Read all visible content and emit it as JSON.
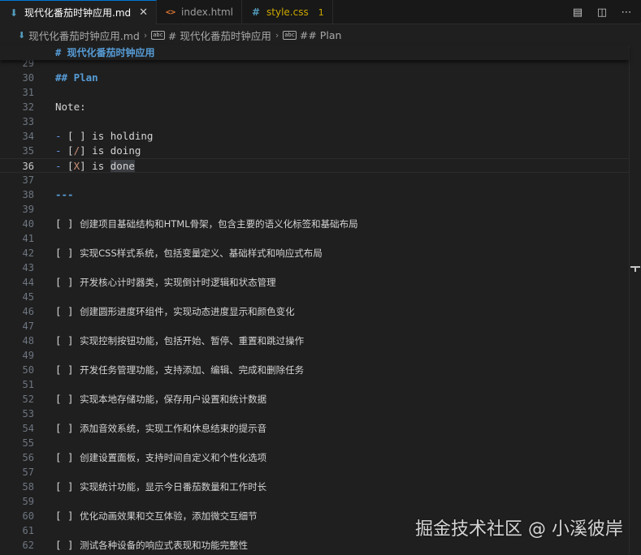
{
  "tabs": [
    {
      "label": "现代化番茄时钟应用.md",
      "icon": "markdown-icon",
      "active": true,
      "close": "✕"
    },
    {
      "label": "index.html",
      "icon": "html-icon",
      "icon_glyph": "<>"
    },
    {
      "label": "style.css",
      "icon": "css-icon",
      "icon_glyph": "#",
      "badge": "1"
    }
  ],
  "tab_actions": [
    "preview-icon",
    "split-editor-icon",
    "more-icon"
  ],
  "breadcrumb": [
    "现代化番茄时钟应用.md",
    "# 现代化番茄时钟应用",
    "## Plan"
  ],
  "sticky_heading": "# 现代化番茄时钟应用",
  "editor": {
    "current_line": 36,
    "lines": [
      {
        "n": "29",
        "text": ""
      },
      {
        "n": "30",
        "text": "## Plan"
      },
      {
        "n": "31",
        "text": ""
      },
      {
        "n": "32",
        "text": "Note:"
      },
      {
        "n": "33",
        "text": ""
      },
      {
        "n": "34",
        "dash": "-",
        "open": " [ ]",
        "rest": " is holding"
      },
      {
        "n": "35",
        "dash": "-",
        "open": " [",
        "mark": "/",
        "close": "]",
        "rest": " is doing"
      },
      {
        "n": "36",
        "dash": "-",
        "open": " [",
        "mark": "X",
        "close": "]",
        "rest": " is ",
        "highlight": "done"
      },
      {
        "n": "37",
        "text": ""
      },
      {
        "n": "38",
        "text": "---"
      },
      {
        "n": "39",
        "text": ""
      },
      {
        "n": "40",
        "box": "[ ]",
        "task": "创建项目基础结构和HTML骨架，包含主要的语义化标签和基础布局"
      },
      {
        "n": "41",
        "text": ""
      },
      {
        "n": "42",
        "box": "[ ]",
        "task": "实现CSS样式系统，包括变量定义、基础样式和响应式布局"
      },
      {
        "n": "43",
        "text": ""
      },
      {
        "n": "44",
        "box": "[ ]",
        "task": "开发核心计时器类，实现倒计时逻辑和状态管理"
      },
      {
        "n": "45",
        "text": ""
      },
      {
        "n": "46",
        "box": "[ ]",
        "task": "创建圆形进度环组件，实现动态进度显示和颜色变化"
      },
      {
        "n": "47",
        "text": ""
      },
      {
        "n": "48",
        "box": "[ ]",
        "task": "实现控制按钮功能，包括开始、暂停、重置和跳过操作"
      },
      {
        "n": "49",
        "text": ""
      },
      {
        "n": "50",
        "box": "[ ]",
        "task": "开发任务管理功能，支持添加、编辑、完成和删除任务"
      },
      {
        "n": "51",
        "text": ""
      },
      {
        "n": "52",
        "box": "[ ]",
        "task": "实现本地存储功能，保存用户设置和统计数据"
      },
      {
        "n": "53",
        "text": ""
      },
      {
        "n": "54",
        "box": "[ ]",
        "task": "添加音效系统，实现工作和休息结束的提示音"
      },
      {
        "n": "55",
        "text": ""
      },
      {
        "n": "56",
        "box": "[ ]",
        "task": "创建设置面板，支持时间自定义和个性化选项"
      },
      {
        "n": "57",
        "text": ""
      },
      {
        "n": "58",
        "box": "[ ]",
        "task": "实现统计功能，显示今日番茄数量和工作时长"
      },
      {
        "n": "59",
        "text": ""
      },
      {
        "n": "60",
        "box": "[ ]",
        "task": "优化动画效果和交互体验，添加微交互细节"
      },
      {
        "n": "61",
        "text": ""
      },
      {
        "n": "62",
        "box": "[ ]",
        "task": "测试各种设备的响应式表现和功能完整性"
      }
    ]
  },
  "watermark": "掘金技术社区 @ 小溪彼岸",
  "colors": {
    "accent": "#0078d4",
    "heading": "#569cd6",
    "warning": "#cca700"
  }
}
